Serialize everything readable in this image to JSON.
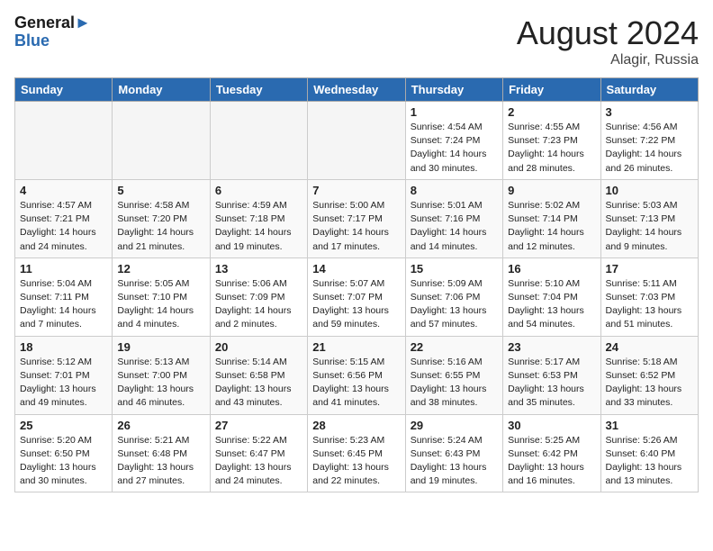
{
  "header": {
    "logo_line1": "General",
    "logo_line2": "Blue",
    "month": "August 2024",
    "location": "Alagir, Russia"
  },
  "weekdays": [
    "Sunday",
    "Monday",
    "Tuesday",
    "Wednesday",
    "Thursday",
    "Friday",
    "Saturday"
  ],
  "weeks": [
    [
      {
        "day": "",
        "empty": true
      },
      {
        "day": "",
        "empty": true
      },
      {
        "day": "",
        "empty": true
      },
      {
        "day": "",
        "empty": true
      },
      {
        "day": "1",
        "sunrise": "4:54 AM",
        "sunset": "7:24 PM",
        "daylight": "14 hours and 30 minutes."
      },
      {
        "day": "2",
        "sunrise": "4:55 AM",
        "sunset": "7:23 PM",
        "daylight": "14 hours and 28 minutes."
      },
      {
        "day": "3",
        "sunrise": "4:56 AM",
        "sunset": "7:22 PM",
        "daylight": "14 hours and 26 minutes."
      }
    ],
    [
      {
        "day": "4",
        "sunrise": "4:57 AM",
        "sunset": "7:21 PM",
        "daylight": "14 hours and 24 minutes."
      },
      {
        "day": "5",
        "sunrise": "4:58 AM",
        "sunset": "7:20 PM",
        "daylight": "14 hours and 21 minutes."
      },
      {
        "day": "6",
        "sunrise": "4:59 AM",
        "sunset": "7:18 PM",
        "daylight": "14 hours and 19 minutes."
      },
      {
        "day": "7",
        "sunrise": "5:00 AM",
        "sunset": "7:17 PM",
        "daylight": "14 hours and 17 minutes."
      },
      {
        "day": "8",
        "sunrise": "5:01 AM",
        "sunset": "7:16 PM",
        "daylight": "14 hours and 14 minutes."
      },
      {
        "day": "9",
        "sunrise": "5:02 AM",
        "sunset": "7:14 PM",
        "daylight": "14 hours and 12 minutes."
      },
      {
        "day": "10",
        "sunrise": "5:03 AM",
        "sunset": "7:13 PM",
        "daylight": "14 hours and 9 minutes."
      }
    ],
    [
      {
        "day": "11",
        "sunrise": "5:04 AM",
        "sunset": "7:11 PM",
        "daylight": "14 hours and 7 minutes."
      },
      {
        "day": "12",
        "sunrise": "5:05 AM",
        "sunset": "7:10 PM",
        "daylight": "14 hours and 4 minutes."
      },
      {
        "day": "13",
        "sunrise": "5:06 AM",
        "sunset": "7:09 PM",
        "daylight": "14 hours and 2 minutes."
      },
      {
        "day": "14",
        "sunrise": "5:07 AM",
        "sunset": "7:07 PM",
        "daylight": "13 hours and 59 minutes."
      },
      {
        "day": "15",
        "sunrise": "5:09 AM",
        "sunset": "7:06 PM",
        "daylight": "13 hours and 57 minutes."
      },
      {
        "day": "16",
        "sunrise": "5:10 AM",
        "sunset": "7:04 PM",
        "daylight": "13 hours and 54 minutes."
      },
      {
        "day": "17",
        "sunrise": "5:11 AM",
        "sunset": "7:03 PM",
        "daylight": "13 hours and 51 minutes."
      }
    ],
    [
      {
        "day": "18",
        "sunrise": "5:12 AM",
        "sunset": "7:01 PM",
        "daylight": "13 hours and 49 minutes."
      },
      {
        "day": "19",
        "sunrise": "5:13 AM",
        "sunset": "7:00 PM",
        "daylight": "13 hours and 46 minutes."
      },
      {
        "day": "20",
        "sunrise": "5:14 AM",
        "sunset": "6:58 PM",
        "daylight": "13 hours and 43 minutes."
      },
      {
        "day": "21",
        "sunrise": "5:15 AM",
        "sunset": "6:56 PM",
        "daylight": "13 hours and 41 minutes."
      },
      {
        "day": "22",
        "sunrise": "5:16 AM",
        "sunset": "6:55 PM",
        "daylight": "13 hours and 38 minutes."
      },
      {
        "day": "23",
        "sunrise": "5:17 AM",
        "sunset": "6:53 PM",
        "daylight": "13 hours and 35 minutes."
      },
      {
        "day": "24",
        "sunrise": "5:18 AM",
        "sunset": "6:52 PM",
        "daylight": "13 hours and 33 minutes."
      }
    ],
    [
      {
        "day": "25",
        "sunrise": "5:20 AM",
        "sunset": "6:50 PM",
        "daylight": "13 hours and 30 minutes."
      },
      {
        "day": "26",
        "sunrise": "5:21 AM",
        "sunset": "6:48 PM",
        "daylight": "13 hours and 27 minutes."
      },
      {
        "day": "27",
        "sunrise": "5:22 AM",
        "sunset": "6:47 PM",
        "daylight": "13 hours and 24 minutes."
      },
      {
        "day": "28",
        "sunrise": "5:23 AM",
        "sunset": "6:45 PM",
        "daylight": "13 hours and 22 minutes."
      },
      {
        "day": "29",
        "sunrise": "5:24 AM",
        "sunset": "6:43 PM",
        "daylight": "13 hours and 19 minutes."
      },
      {
        "day": "30",
        "sunrise": "5:25 AM",
        "sunset": "6:42 PM",
        "daylight": "13 hours and 16 minutes."
      },
      {
        "day": "31",
        "sunrise": "5:26 AM",
        "sunset": "6:40 PM",
        "daylight": "13 hours and 13 minutes."
      }
    ]
  ]
}
